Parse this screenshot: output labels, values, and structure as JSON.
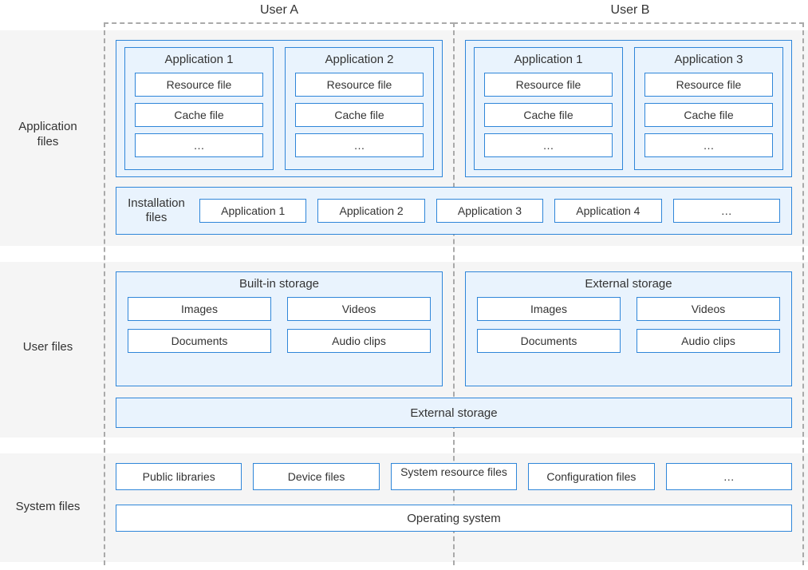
{
  "users": {
    "a": "User A",
    "b": "User B"
  },
  "rows": {
    "application_files": "Application\nfiles",
    "user_files": "User files",
    "system_files": "System files"
  },
  "app_blocks": {
    "userA": [
      {
        "title": "Application 1",
        "items": [
          "Resource file",
          "Cache file",
          "…"
        ]
      },
      {
        "title": "Application 2",
        "items": [
          "Resource file",
          "Cache file",
          "…"
        ]
      }
    ],
    "userB": [
      {
        "title": "Application 1",
        "items": [
          "Resource file",
          "Cache file",
          "…"
        ]
      },
      {
        "title": "Application 3",
        "items": [
          "Resource file",
          "Cache file",
          "…"
        ]
      }
    ]
  },
  "installation": {
    "label": "Installation\nfiles",
    "items": [
      "Application 1",
      "Application 2",
      "Application 3",
      "Application 4",
      "…"
    ]
  },
  "storage": {
    "builtin": {
      "title": "Built-in storage",
      "items": [
        "Images",
        "Videos",
        "Documents",
        "Audio clips"
      ]
    },
    "external": {
      "title": "External storage",
      "items": [
        "Images",
        "Videos",
        "Documents",
        "Audio clips"
      ]
    },
    "shared_external": "External storage"
  },
  "system": {
    "top_row": [
      "Public libraries",
      "Device files",
      "System resource files",
      "Configuration files",
      "…"
    ],
    "bottom": "Operating system"
  }
}
